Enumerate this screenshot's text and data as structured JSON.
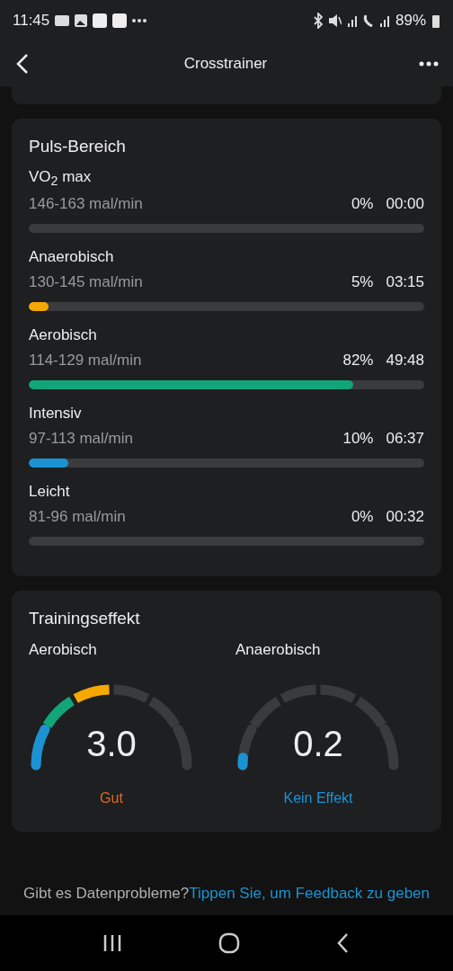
{
  "status_bar": {
    "time": "11:45",
    "battery": "89%"
  },
  "header": {
    "title": "Crosstrainer"
  },
  "pulse_zones": {
    "title": "Puls-Bereich",
    "zones": [
      {
        "name": "VO$_{2}$ max",
        "range": "146-163 mal/min",
        "percent": "0%",
        "time": "00:00"
      },
      {
        "name": "Anaerobisch",
        "range": "130-145 mal/min",
        "percent": "5%",
        "time": "03:15",
        "level": 0.05,
        "color": "#f5a800"
      },
      {
        "name": "Aerobisch",
        "range": "114-129 mal/min",
        "percent": "82%",
        "time": "49:48",
        "level": 0.82,
        "color": "#12a57a"
      },
      {
        "name": "Intensiv",
        "range": "97-113 mal/min",
        "percent": "10%",
        "time": "06:37",
        "level": 0.1,
        "color": "#1b93d2"
      },
      {
        "name": "Leicht",
        "range": "81-96 mal/min",
        "percent": "0%",
        "time": "00:32"
      }
    ]
  },
  "training_effect": {
    "title": "Trainingseffekt",
    "gauges": [
      {
        "label": "Aerobisch",
        "value": "3.0",
        "rating": "Gut"
      },
      {
        "label": "Anaerobisch",
        "value": "0.2",
        "rating": "Kein Effekt"
      }
    ]
  },
  "footer": {
    "question": "Gibt es Datenprobleme?",
    "link": "Tippen Sie, um Feedback zu geben"
  }
}
